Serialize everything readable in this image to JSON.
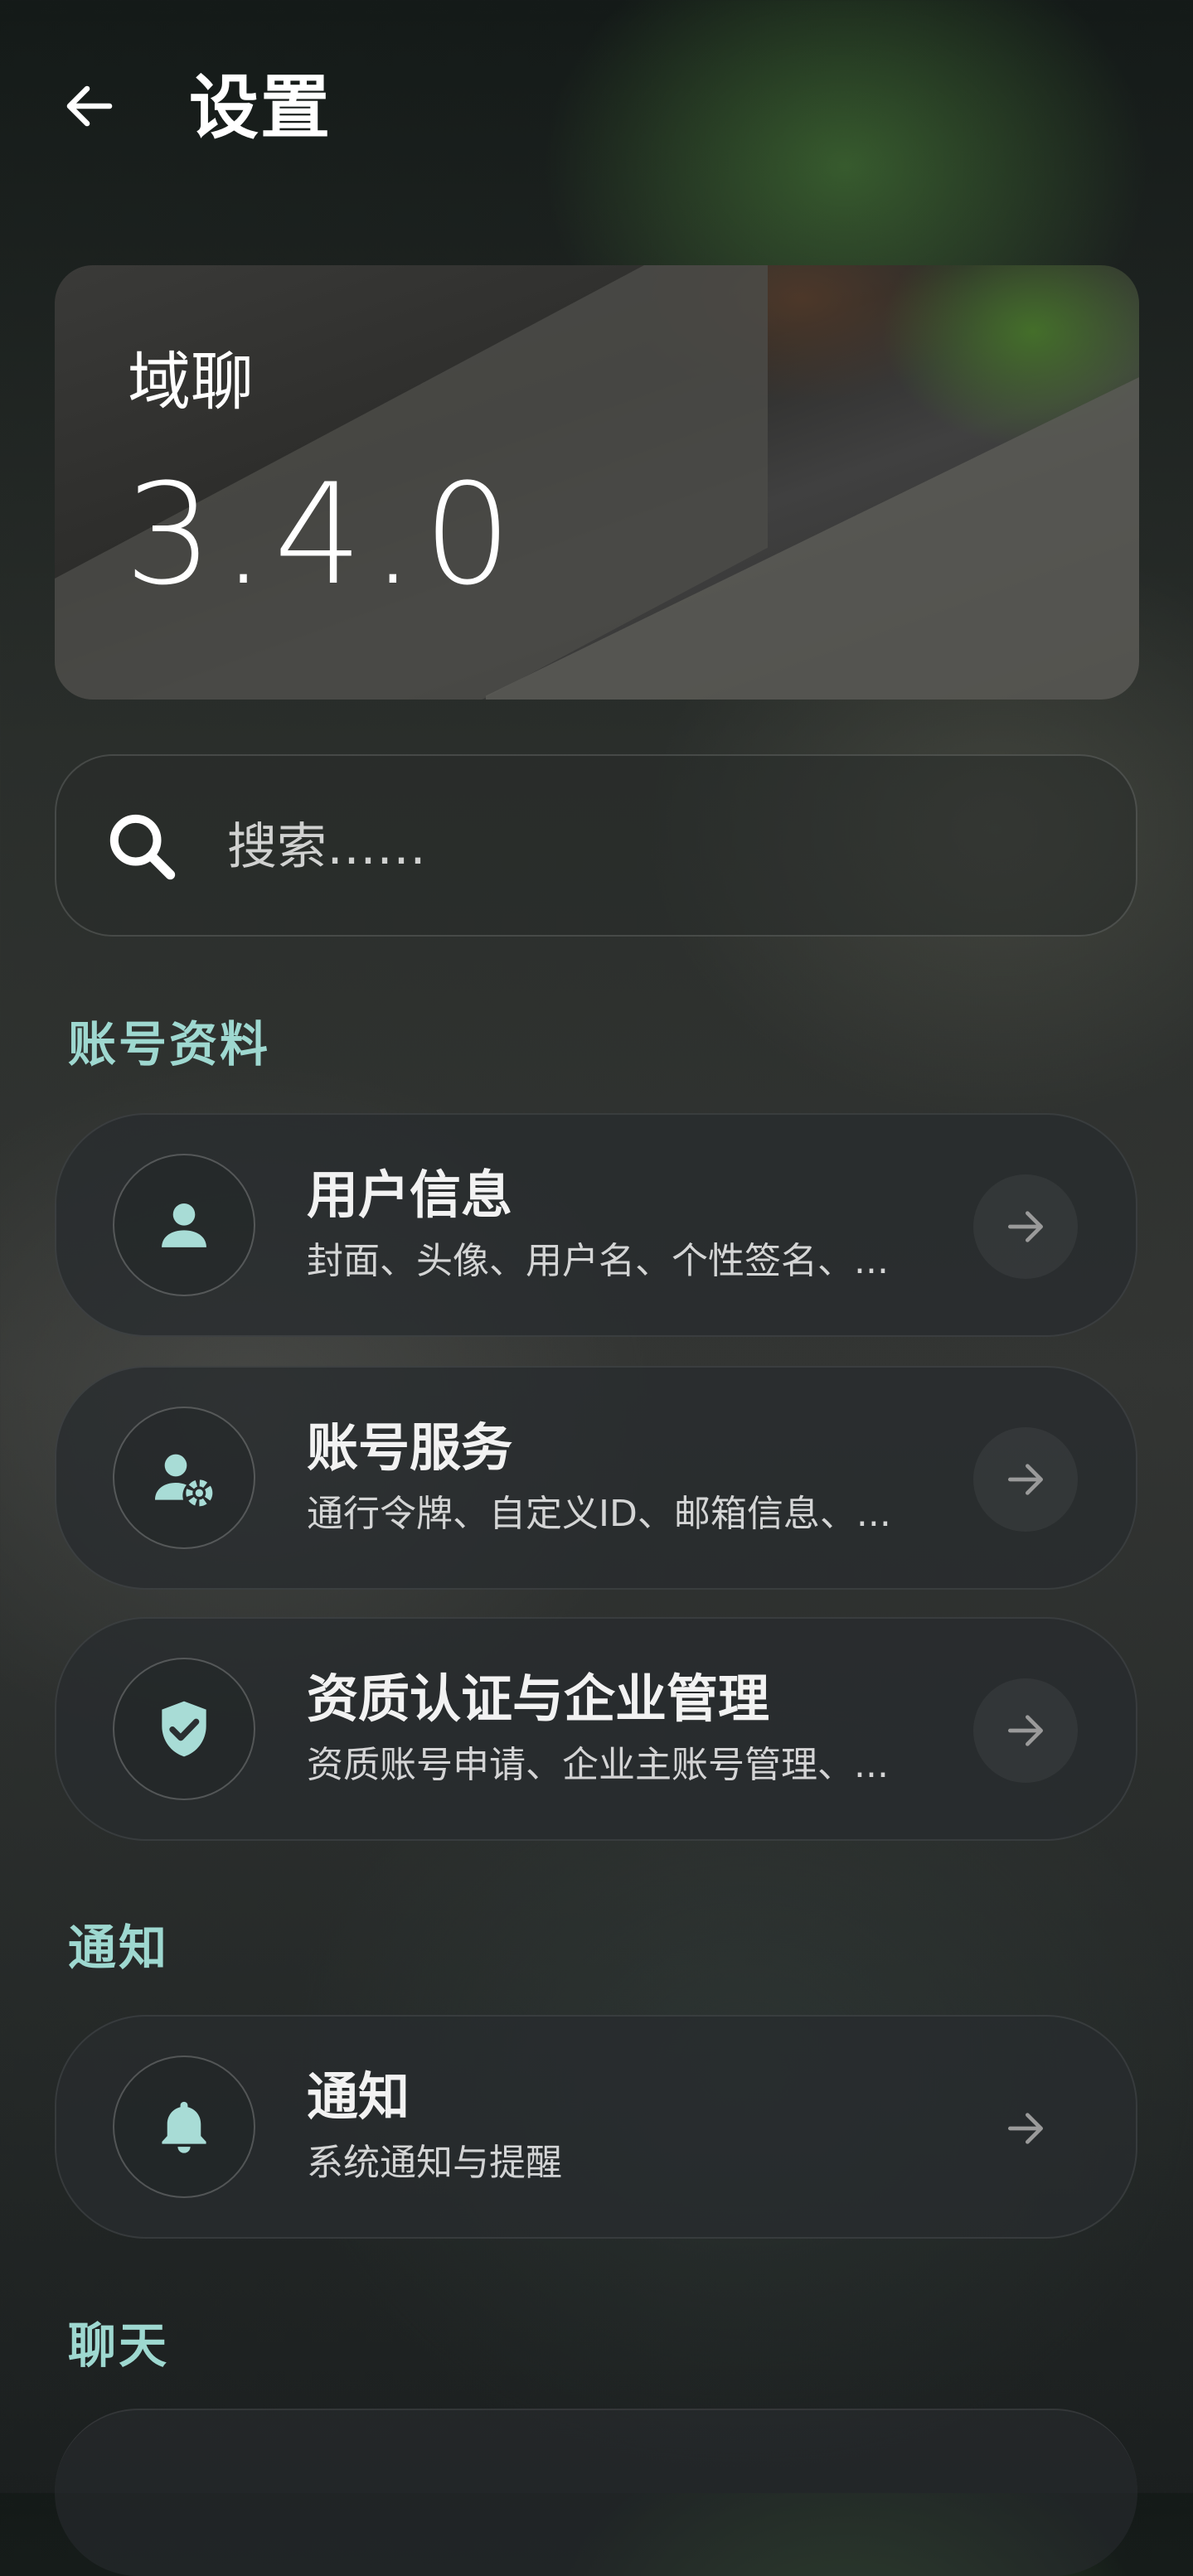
{
  "header": {
    "title": "设置",
    "back_icon": "arrow-left-icon"
  },
  "banner": {
    "app_name": "域聊",
    "version": "3.4.0"
  },
  "search": {
    "placeholder": "搜索……",
    "icon": "search-icon"
  },
  "sections": {
    "account": {
      "title": "账号资料",
      "items": [
        {
          "title": "用户信息",
          "subtitle": "封面、头像、用户名、个性签名、...",
          "icon": "user-icon"
        },
        {
          "title": "账号服务",
          "subtitle": "通行令牌、自定义ID、邮箱信息、...",
          "icon": "user-gear-icon"
        },
        {
          "title": "资质认证与企业管理",
          "subtitle": "资质账号申请、企业主账号管理、...",
          "icon": "shield-check-icon"
        }
      ]
    },
    "notifications": {
      "title": "通知",
      "items": [
        {
          "title": "通知",
          "subtitle": "系统通知与提醒",
          "icon": "bell-icon"
        }
      ]
    },
    "chat": {
      "title": "聊天"
    }
  },
  "colors": {
    "accent": "#9ed8d0",
    "icon_fill": "#a8dcd6"
  }
}
